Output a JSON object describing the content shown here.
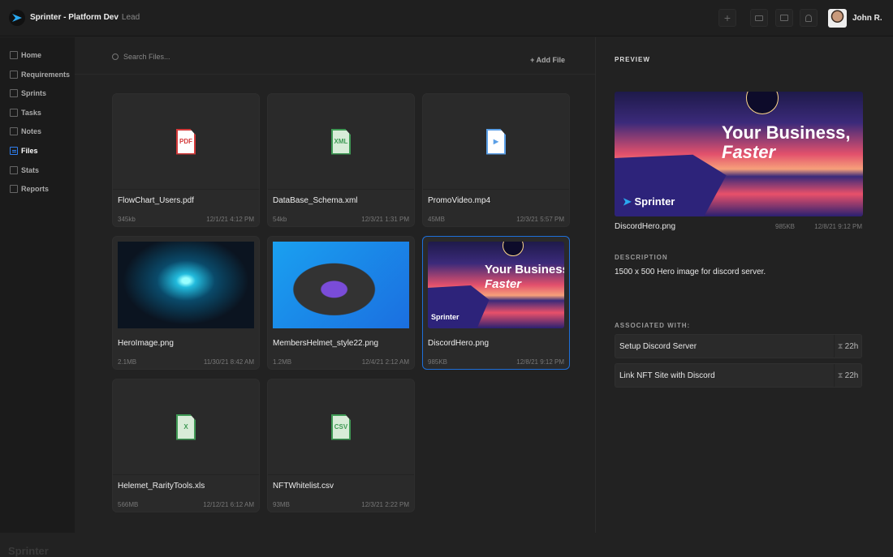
{
  "header": {
    "app_title": "Sprinter - Platform Dev",
    "role": "Lead",
    "user_name": "John R.",
    "add_icon": "plus-icon",
    "video_icon": "video-icon",
    "chat_icon": "chat-icon",
    "bell_icon": "bell-icon"
  },
  "sidebar": {
    "items": [
      {
        "label": "Home",
        "icon": "home-icon"
      },
      {
        "label": "Requirements",
        "icon": "requirements-icon"
      },
      {
        "label": "Sprints",
        "icon": "stopwatch-icon"
      },
      {
        "label": "Tasks",
        "icon": "clipboard-icon"
      },
      {
        "label": "Notes",
        "icon": "note-icon"
      },
      {
        "label": "Files",
        "icon": "files-icon",
        "active": true
      },
      {
        "label": "Stats",
        "icon": "stats-icon"
      },
      {
        "label": "Reports",
        "icon": "report-icon"
      }
    ],
    "footer_logo": "Sprinter"
  },
  "main": {
    "search_placeholder": "Search Files...",
    "add_file": "+ Add File",
    "files": [
      {
        "name": "FlowChart_Users.pdf",
        "size": "345kb",
        "date": "12/1/21 4:12 PM",
        "type": "PDF",
        "color": "#d33a3a"
      },
      {
        "name": "DataBase_Schema.xml",
        "size": "54kb",
        "date": "12/3/21 1:31 PM",
        "type": "XML",
        "color": "#3f9a55"
      },
      {
        "name": "PromoVideo.mp4",
        "size": "45MB",
        "date": "12/3/21 5:57 PM",
        "type": "video",
        "color": "#5b9fe6"
      },
      {
        "name": "HeroImage.png",
        "size": "2.1MB",
        "date": "11/30/21 8:42 AM",
        "type": "image-hero"
      },
      {
        "name": "MembersHelmet_style22.png",
        "size": "1.2MB",
        "date": "12/4/21 2:12 AM",
        "type": "image-helmet"
      },
      {
        "name": "DiscordHero.png",
        "size": "985KB",
        "date": "12/8/21 9:12 PM",
        "type": "image-discord",
        "selected": true
      },
      {
        "name": "Helemet_RarityTools.xls",
        "size": "566MB",
        "date": "12/12/21 6:12 AM",
        "type": "X",
        "color": "#3f9a55"
      },
      {
        "name": "NFTWhitelist.csv",
        "size": "93MB",
        "date": "12/3/21 2:22 PM",
        "type": "CSV",
        "color": "#3f9a55"
      }
    ]
  },
  "preview": {
    "label": "PREVIEW",
    "file_name": "DiscordHero.png",
    "size": "985KB",
    "date": "12/8/21 9:12 PM",
    "image_text": {
      "line1": "Your Business,",
      "line2": "Faster",
      "brand": "Sprinter"
    },
    "description_label": "DESCRIPTION",
    "description": "1500 x 500 Hero image for discord server.",
    "associated_label": "ASSOCIATED WITH:",
    "associated": [
      {
        "title": "Setup Discord Server",
        "time": "22h"
      },
      {
        "title": "Link NFT Site with Discord",
        "time": "22h"
      }
    ]
  },
  "colors": {
    "accent": "#1e6fd9",
    "background": "#222222"
  }
}
